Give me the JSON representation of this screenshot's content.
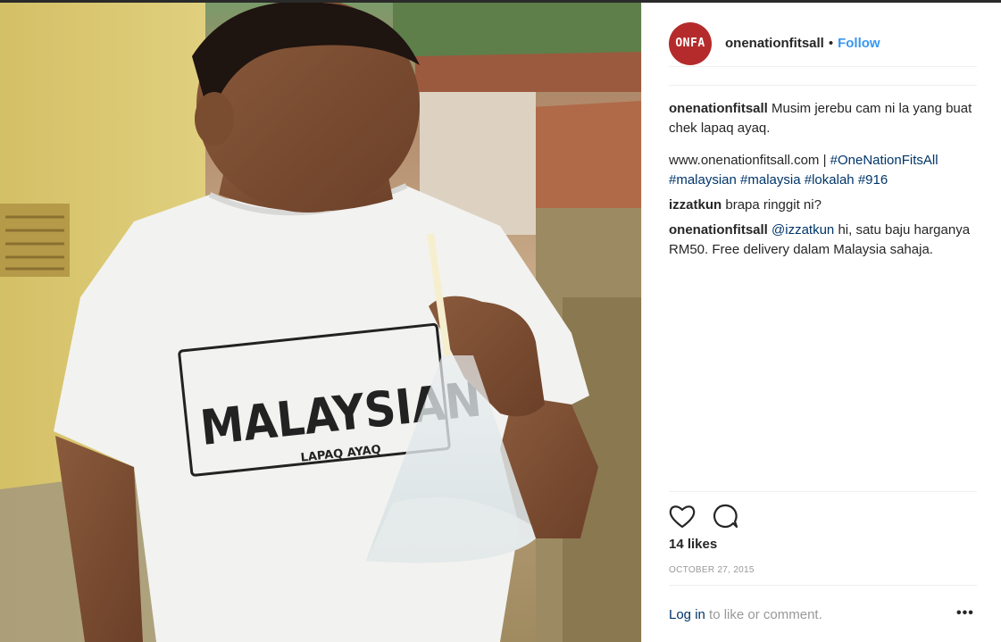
{
  "post": {
    "avatar_text": "ONFA",
    "username": "onenationfitsall",
    "separator": "•",
    "follow_label": "Follow",
    "shirt_main_text": "MALAYSIAN",
    "shirt_sub_text": "LAPAQ AYAQ"
  },
  "comments": [
    {
      "username": "onenationfitsall",
      "text": " Musim jerebu cam ni la yang buat chek lapaq ayaq.",
      "extra_plain": "www.onenationfitsall.com | ",
      "tags": [
        "#OneNationFitsAll",
        "#malaysian",
        "#malaysia",
        "#lokalah",
        "#916"
      ]
    },
    {
      "username": "izzatkun",
      "text": " brapa ringgit ni?"
    },
    {
      "username": "onenationfitsall",
      "mention": "@izzatkun",
      "text": " hi, satu baju harganya RM50. Free delivery dalam Malaysia sahaja."
    }
  ],
  "actions": {
    "like_icon": "heart-icon",
    "comment_icon": "comment-icon",
    "likes_text": "14 likes",
    "date": "OCTOBER 27, 2015"
  },
  "footer": {
    "login_link": "Log in",
    "login_rest": " to like or comment.",
    "more_label": "•••"
  }
}
